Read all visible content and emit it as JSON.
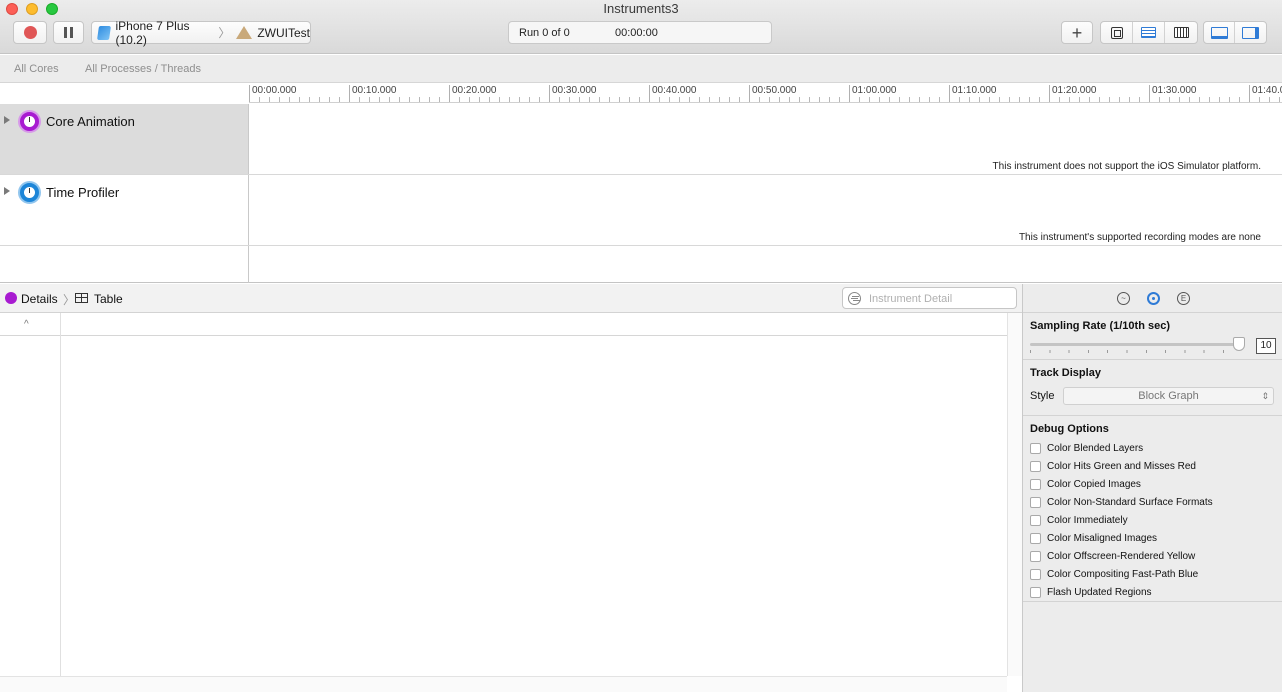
{
  "window": {
    "title": "Instruments3"
  },
  "toolbar": {
    "record_icon": "record-icon",
    "pause_icon": "pause-icon",
    "device": "iPhone 7 Plus (10.2)",
    "target_app": "ZWUITest",
    "run_label": "Run 0 of 0",
    "run_time": "00:00:00",
    "add_label": "+"
  },
  "filterbar": {
    "cores": "All Cores",
    "processes": "All Processes / Threads"
  },
  "ruler": {
    "labels": [
      "00:00.000",
      "00:10.000",
      "00:20.000",
      "00:30.000",
      "00:40.000",
      "00:50.000",
      "01:00.000",
      "01:10.000",
      "01:20.000",
      "01:30.000",
      "01:40.0"
    ]
  },
  "tracks": [
    {
      "name": "Core Animation",
      "message": "This instrument does not support the iOS Simulator platform.",
      "color": "#a81bd1"
    },
    {
      "name": "Time Profiler",
      "message": "This instrument's supported recording modes are none",
      "color": "#1c85d8"
    }
  ],
  "detail": {
    "label": "Details",
    "table_label": "Table",
    "search_placeholder": "Instrument Detail",
    "sort_caret": "^"
  },
  "inspector": {
    "tab_icons": [
      "record-settings-icon",
      "display-settings-icon",
      "extended-detail-icon"
    ],
    "sampling_title": "Sampling Rate (1/10th sec)",
    "sampling_value": "10",
    "track_display_title": "Track Display",
    "style_label": "Style",
    "style_value": "Block Graph",
    "debug_title": "Debug Options",
    "debug_options": [
      "Color Blended Layers",
      "Color Hits Green and Misses Red",
      "Color Copied Images",
      "Color Non-Standard Surface Formats",
      "Color Immediately",
      "Color Misaligned Images",
      "Color Offscreen-Rendered Yellow",
      "Color Compositing Fast-Path Blue",
      "Flash Updated Regions"
    ]
  },
  "colors": {
    "accent": "#2f7bd6",
    "record": "#e05656"
  }
}
